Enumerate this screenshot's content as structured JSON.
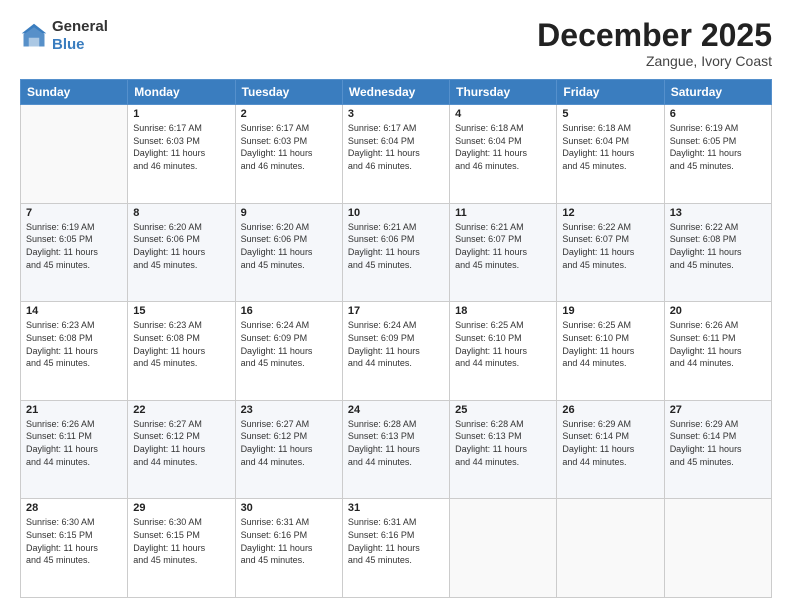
{
  "header": {
    "logo_general": "General",
    "logo_blue": "Blue",
    "month_title": "December 2025",
    "location": "Zangue, Ivory Coast"
  },
  "days_of_week": [
    "Sunday",
    "Monday",
    "Tuesday",
    "Wednesday",
    "Thursday",
    "Friday",
    "Saturday"
  ],
  "weeks": [
    [
      {
        "day": "",
        "info": ""
      },
      {
        "day": "1",
        "info": "Sunrise: 6:17 AM\nSunset: 6:03 PM\nDaylight: 11 hours\nand 46 minutes."
      },
      {
        "day": "2",
        "info": "Sunrise: 6:17 AM\nSunset: 6:03 PM\nDaylight: 11 hours\nand 46 minutes."
      },
      {
        "day": "3",
        "info": "Sunrise: 6:17 AM\nSunset: 6:04 PM\nDaylight: 11 hours\nand 46 minutes."
      },
      {
        "day": "4",
        "info": "Sunrise: 6:18 AM\nSunset: 6:04 PM\nDaylight: 11 hours\nand 46 minutes."
      },
      {
        "day": "5",
        "info": "Sunrise: 6:18 AM\nSunset: 6:04 PM\nDaylight: 11 hours\nand 45 minutes."
      },
      {
        "day": "6",
        "info": "Sunrise: 6:19 AM\nSunset: 6:05 PM\nDaylight: 11 hours\nand 45 minutes."
      }
    ],
    [
      {
        "day": "7",
        "info": "Sunrise: 6:19 AM\nSunset: 6:05 PM\nDaylight: 11 hours\nand 45 minutes."
      },
      {
        "day": "8",
        "info": "Sunrise: 6:20 AM\nSunset: 6:06 PM\nDaylight: 11 hours\nand 45 minutes."
      },
      {
        "day": "9",
        "info": "Sunrise: 6:20 AM\nSunset: 6:06 PM\nDaylight: 11 hours\nand 45 minutes."
      },
      {
        "day": "10",
        "info": "Sunrise: 6:21 AM\nSunset: 6:06 PM\nDaylight: 11 hours\nand 45 minutes."
      },
      {
        "day": "11",
        "info": "Sunrise: 6:21 AM\nSunset: 6:07 PM\nDaylight: 11 hours\nand 45 minutes."
      },
      {
        "day": "12",
        "info": "Sunrise: 6:22 AM\nSunset: 6:07 PM\nDaylight: 11 hours\nand 45 minutes."
      },
      {
        "day": "13",
        "info": "Sunrise: 6:22 AM\nSunset: 6:08 PM\nDaylight: 11 hours\nand 45 minutes."
      }
    ],
    [
      {
        "day": "14",
        "info": "Sunrise: 6:23 AM\nSunset: 6:08 PM\nDaylight: 11 hours\nand 45 minutes."
      },
      {
        "day": "15",
        "info": "Sunrise: 6:23 AM\nSunset: 6:08 PM\nDaylight: 11 hours\nand 45 minutes."
      },
      {
        "day": "16",
        "info": "Sunrise: 6:24 AM\nSunset: 6:09 PM\nDaylight: 11 hours\nand 45 minutes."
      },
      {
        "day": "17",
        "info": "Sunrise: 6:24 AM\nSunset: 6:09 PM\nDaylight: 11 hours\nand 44 minutes."
      },
      {
        "day": "18",
        "info": "Sunrise: 6:25 AM\nSunset: 6:10 PM\nDaylight: 11 hours\nand 44 minutes."
      },
      {
        "day": "19",
        "info": "Sunrise: 6:25 AM\nSunset: 6:10 PM\nDaylight: 11 hours\nand 44 minutes."
      },
      {
        "day": "20",
        "info": "Sunrise: 6:26 AM\nSunset: 6:11 PM\nDaylight: 11 hours\nand 44 minutes."
      }
    ],
    [
      {
        "day": "21",
        "info": "Sunrise: 6:26 AM\nSunset: 6:11 PM\nDaylight: 11 hours\nand 44 minutes."
      },
      {
        "day": "22",
        "info": "Sunrise: 6:27 AM\nSunset: 6:12 PM\nDaylight: 11 hours\nand 44 minutes."
      },
      {
        "day": "23",
        "info": "Sunrise: 6:27 AM\nSunset: 6:12 PM\nDaylight: 11 hours\nand 44 minutes."
      },
      {
        "day": "24",
        "info": "Sunrise: 6:28 AM\nSunset: 6:13 PM\nDaylight: 11 hours\nand 44 minutes."
      },
      {
        "day": "25",
        "info": "Sunrise: 6:28 AM\nSunset: 6:13 PM\nDaylight: 11 hours\nand 44 minutes."
      },
      {
        "day": "26",
        "info": "Sunrise: 6:29 AM\nSunset: 6:14 PM\nDaylight: 11 hours\nand 44 minutes."
      },
      {
        "day": "27",
        "info": "Sunrise: 6:29 AM\nSunset: 6:14 PM\nDaylight: 11 hours\nand 45 minutes."
      }
    ],
    [
      {
        "day": "28",
        "info": "Sunrise: 6:30 AM\nSunset: 6:15 PM\nDaylight: 11 hours\nand 45 minutes."
      },
      {
        "day": "29",
        "info": "Sunrise: 6:30 AM\nSunset: 6:15 PM\nDaylight: 11 hours\nand 45 minutes."
      },
      {
        "day": "30",
        "info": "Sunrise: 6:31 AM\nSunset: 6:16 PM\nDaylight: 11 hours\nand 45 minutes."
      },
      {
        "day": "31",
        "info": "Sunrise: 6:31 AM\nSunset: 6:16 PM\nDaylight: 11 hours\nand 45 minutes."
      },
      {
        "day": "",
        "info": ""
      },
      {
        "day": "",
        "info": ""
      },
      {
        "day": "",
        "info": ""
      }
    ]
  ]
}
